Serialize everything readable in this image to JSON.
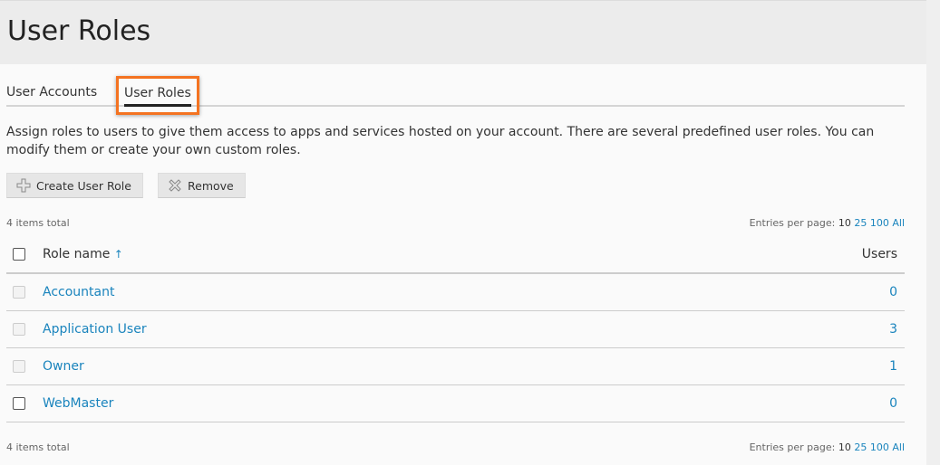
{
  "page": {
    "title": "User Roles"
  },
  "tabs": [
    {
      "label": "User Accounts"
    },
    {
      "label": "User Roles",
      "active": true
    }
  ],
  "description": "Assign roles to users to give them access to apps and services hosted on your account. There are several predefined user roles. You can modify them or create your own custom roles.",
  "toolbar": {
    "create_label": "Create User Role",
    "remove_label": "Remove"
  },
  "summary": {
    "total": "4 items total",
    "entries_label": "Entries per page:",
    "entries_options": [
      "10",
      "25",
      "100",
      "All"
    ],
    "entries_selected": "10"
  },
  "table": {
    "headers": {
      "name": "Role name",
      "sort_icon": "↑",
      "users": "Users"
    },
    "rows": [
      {
        "name": "Accountant",
        "users": "0",
        "selectable": false
      },
      {
        "name": "Application User",
        "users": "3",
        "selectable": false
      },
      {
        "name": "Owner",
        "users": "1",
        "selectable": false
      },
      {
        "name": "WebMaster",
        "users": "0",
        "selectable": true
      }
    ]
  },
  "colors": {
    "link": "#1a84bd",
    "highlight": "#f47321"
  }
}
